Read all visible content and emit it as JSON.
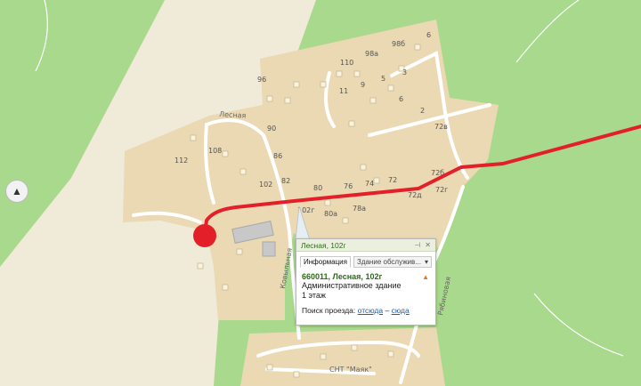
{
  "map": {
    "accent_colors": {
      "route": "#e3202a",
      "marker": "#e3202a",
      "land": "#ead9b2",
      "forest": "#a9d98c",
      "roads": "#ffffff"
    },
    "street_labels": {
      "lesnaya": "Лесная",
      "kovylnaya": "Ковыльная",
      "ryabinovaya": "Рябиновая",
      "snt": "СНТ \"Маяк\""
    },
    "house_numbers": {
      "h6a": "6",
      "h98b": "98б",
      "h110": "110",
      "h98a": "98а",
      "h96": "96",
      "h5": "5",
      "h3": "3",
      "h9": "9",
      "h11": "11",
      "h6b": "6",
      "h2": "2",
      "h90": "90",
      "h72v": "72в",
      "h112": "112",
      "h108": "108",
      "h86": "86",
      "h72b": "72б",
      "h82": "82",
      "h102": "102",
      "h80": "80",
      "h76": "76",
      "h74": "74",
      "h72": "72",
      "h72d": "72д",
      "h72g": "72г",
      "h102g": "102г",
      "h80a": "80а",
      "h78a": "78а"
    },
    "nav_icon": "north-arrow-icon"
  },
  "popup": {
    "title": "Лесная, 102г",
    "pin_icon": "pin-icon",
    "close_icon": "close-icon",
    "tabs": {
      "info": "Информация",
      "service": "Здание обслужив..."
    },
    "address": "660011, Лесная, 102г",
    "building_type": "Административное здание",
    "floors": "1 этаж",
    "route_label": "Поиск проезда:",
    "route_from": "отсюда",
    "route_sep": "–",
    "route_to": "сюда",
    "warning_icon": "warning-icon"
  }
}
